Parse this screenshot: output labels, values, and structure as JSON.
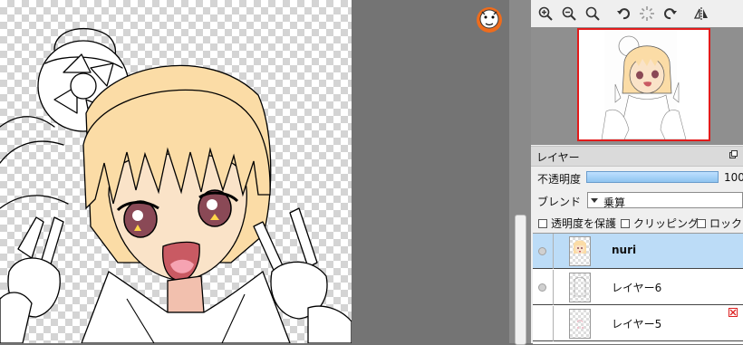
{
  "panel": {
    "toolbar": [
      {
        "icon": "zoom-in-icon"
      },
      {
        "icon": "zoom-out-icon"
      },
      {
        "icon": "zoom-reset-icon"
      },
      {
        "icon": "rotate-left-icon"
      },
      {
        "icon": "rotate-reset-icon"
      },
      {
        "icon": "rotate-right-icon"
      },
      {
        "icon": "flip-horizontal-icon"
      }
    ],
    "layer_section_title": "レイヤー",
    "opacity_label": "不透明度",
    "opacity_value": "100",
    "opacity_fraction": 1.0,
    "blend_label": "ブレンド",
    "blend_value": "乗算",
    "protect_label": "透明度を保護",
    "clipping_label": "クリッピング",
    "lock_label": "ロック",
    "layers": [
      {
        "name": "nuri",
        "selected": true
      },
      {
        "name": "レイヤー6",
        "selected": false
      },
      {
        "name": "レイヤー5",
        "selected": false
      }
    ]
  },
  "colors": {
    "selection": "#bcdcf7",
    "navigator_frame": "#e21b1b",
    "opacity_bar": "#8fc4f0",
    "skin": "#fae3c8",
    "hair": "#fbdca6",
    "eye": "#8a4956"
  }
}
